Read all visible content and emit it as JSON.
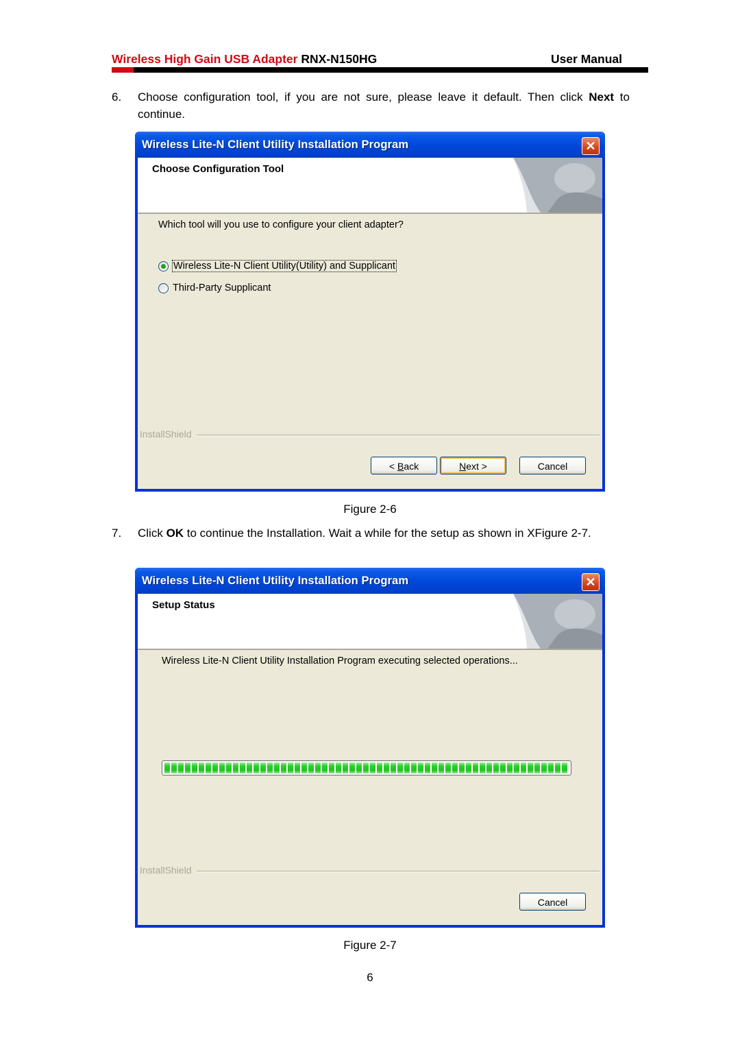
{
  "header": {
    "product_red": "Wireless High Gain USB Adapter",
    "model": "RNX-N150HG",
    "doc_type": "User Manual",
    "accent_color": "#d20a14"
  },
  "step6": {
    "number": "6.",
    "text_before": "Choose configuration tool, if you are not sure, please leave it default. Then click ",
    "bold": "Next",
    "text_after": " to continue."
  },
  "figure6": {
    "dialog": {
      "title": "Wireless Lite-N Client Utility Installation Program",
      "close_icon": "close-icon",
      "banner_title": "Choose Configuration Tool",
      "question": "Which tool will you use to configure your client adapter?",
      "options": [
        {
          "label": "Wireless Lite-N Client Utility(Utility) and Supplicant",
          "selected": true
        },
        {
          "label": "Third-Party Supplicant",
          "selected": false
        }
      ],
      "installshield_label": "InstallShield",
      "buttons": {
        "back_prefix": "< ",
        "back_mnemonic": "B",
        "back_rest": "ack",
        "next_mnemonic": "N",
        "next_rest": "ext >",
        "cancel": "Cancel"
      }
    },
    "caption": "Figure 2-6"
  },
  "step7": {
    "number": "7.",
    "text_before": "Click ",
    "bold": "OK",
    "text_after": " to continue the Installation. Wait a while for the setup as shown in XFigure 2-7."
  },
  "figure7": {
    "dialog": {
      "title": "Wireless Lite-N Client Utility Installation Program",
      "close_icon": "close-icon",
      "banner_title": "Setup Status",
      "status_text": "Wireless Lite-N Client Utility Installation Program executing selected operations...",
      "progress_percent": 100,
      "progress_color": "#2ed22e",
      "installshield_label": "InstallShield",
      "buttons": {
        "cancel": "Cancel"
      }
    },
    "caption": "Figure 2-7"
  },
  "page_number": "6"
}
